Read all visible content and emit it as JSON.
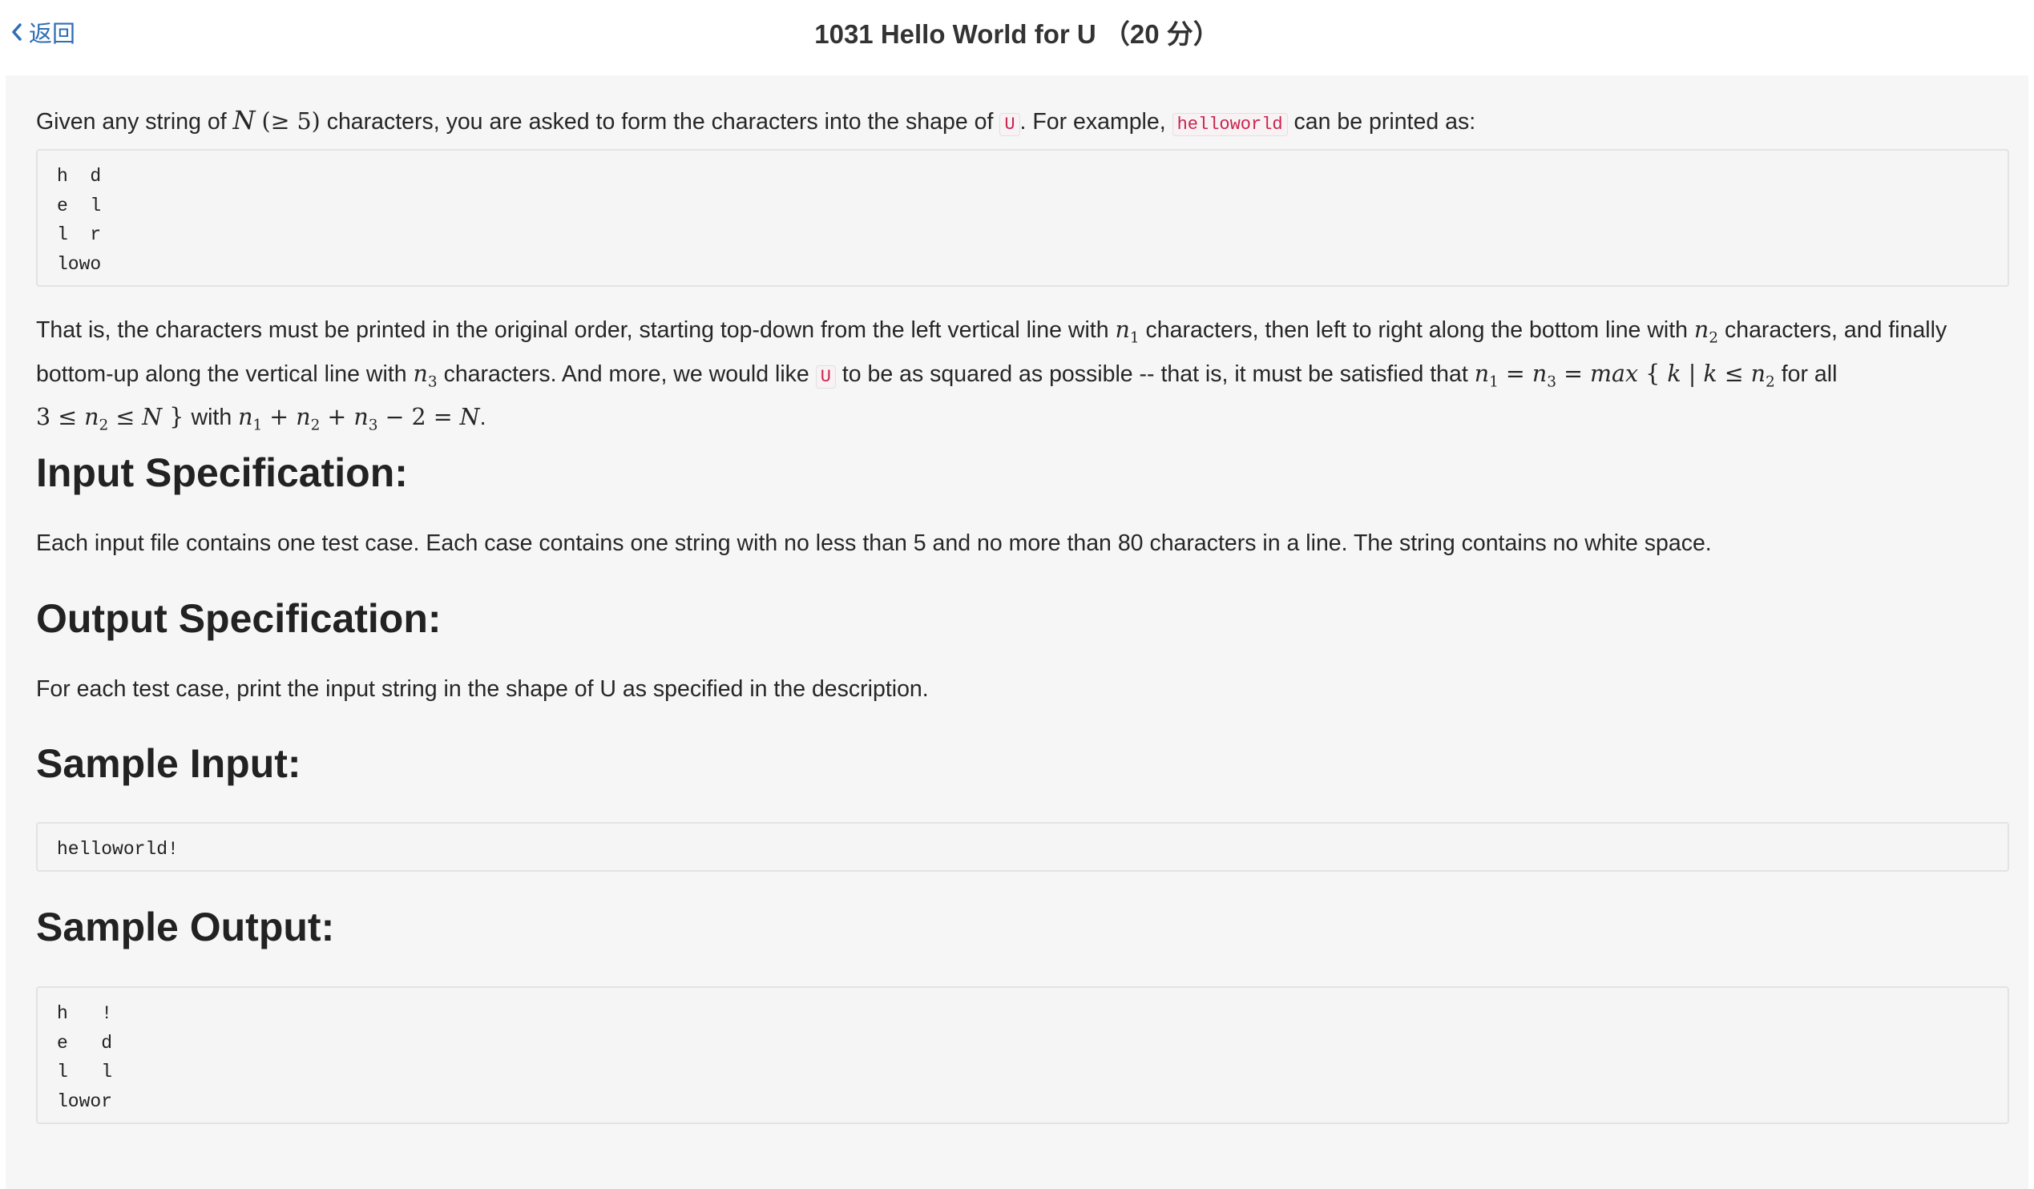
{
  "header": {
    "back_label": "返回",
    "title": "1031 Hello World for U （20 分）"
  },
  "intro": {
    "t1": "Given any string of ",
    "m_N": "N",
    "m_cond": "(≥ 5)",
    "t2": " characters, you are asked to form the characters into the shape of ",
    "code_U": "U",
    "t3": ". For example, ",
    "code_hw": "helloworld",
    "t4": " can be printed as:"
  },
  "example_block": "h  d\ne  l\nl  r\nlowo",
  "para2": {
    "t1": "That is, the characters must be printed in the original order, starting top-down from the left vertical line with ",
    "n": "n",
    "s1": "1",
    "t2": " characters, then left to right along the bottom line with ",
    "s2": "2",
    "t3": " characters, and finally bottom-up along the vertical line with ",
    "s3": "3",
    "t4": " characters. And more, we would like ",
    "code_U": "U",
    "t5": " to be as squared as possible -- that is, it must be satisfied that ",
    "eq1": " = ",
    "eq2": " = ",
    "max": "max",
    "set_open": " { ",
    "k": "k",
    "bar": " | ",
    "le": " ≤ ",
    "t6": " for all",
    "three": "3",
    "N": "N",
    "set_close": " } ",
    "t7": "with ",
    "plus": " + ",
    "minus2": " − 2 = ",
    "period": "."
  },
  "input_spec": {
    "heading": "Input Specification:",
    "text": "Each input file contains one test case. Each case contains one string with no less than 5 and no more than 80 characters in a line. The string contains no white space."
  },
  "output_spec": {
    "heading": "Output Specification:",
    "text": "For each test case, print the input string in the shape of U as specified in the description."
  },
  "sample_input": {
    "heading": "Sample Input:",
    "code": "helloworld!"
  },
  "sample_output": {
    "heading": "Sample Output:",
    "code": "h   !\ne   d\nl   l\nlowor"
  },
  "colors": {
    "link": "#2f6eb5",
    "panel_bg": "#f6f6f6",
    "inline_code": "#c7254e"
  }
}
